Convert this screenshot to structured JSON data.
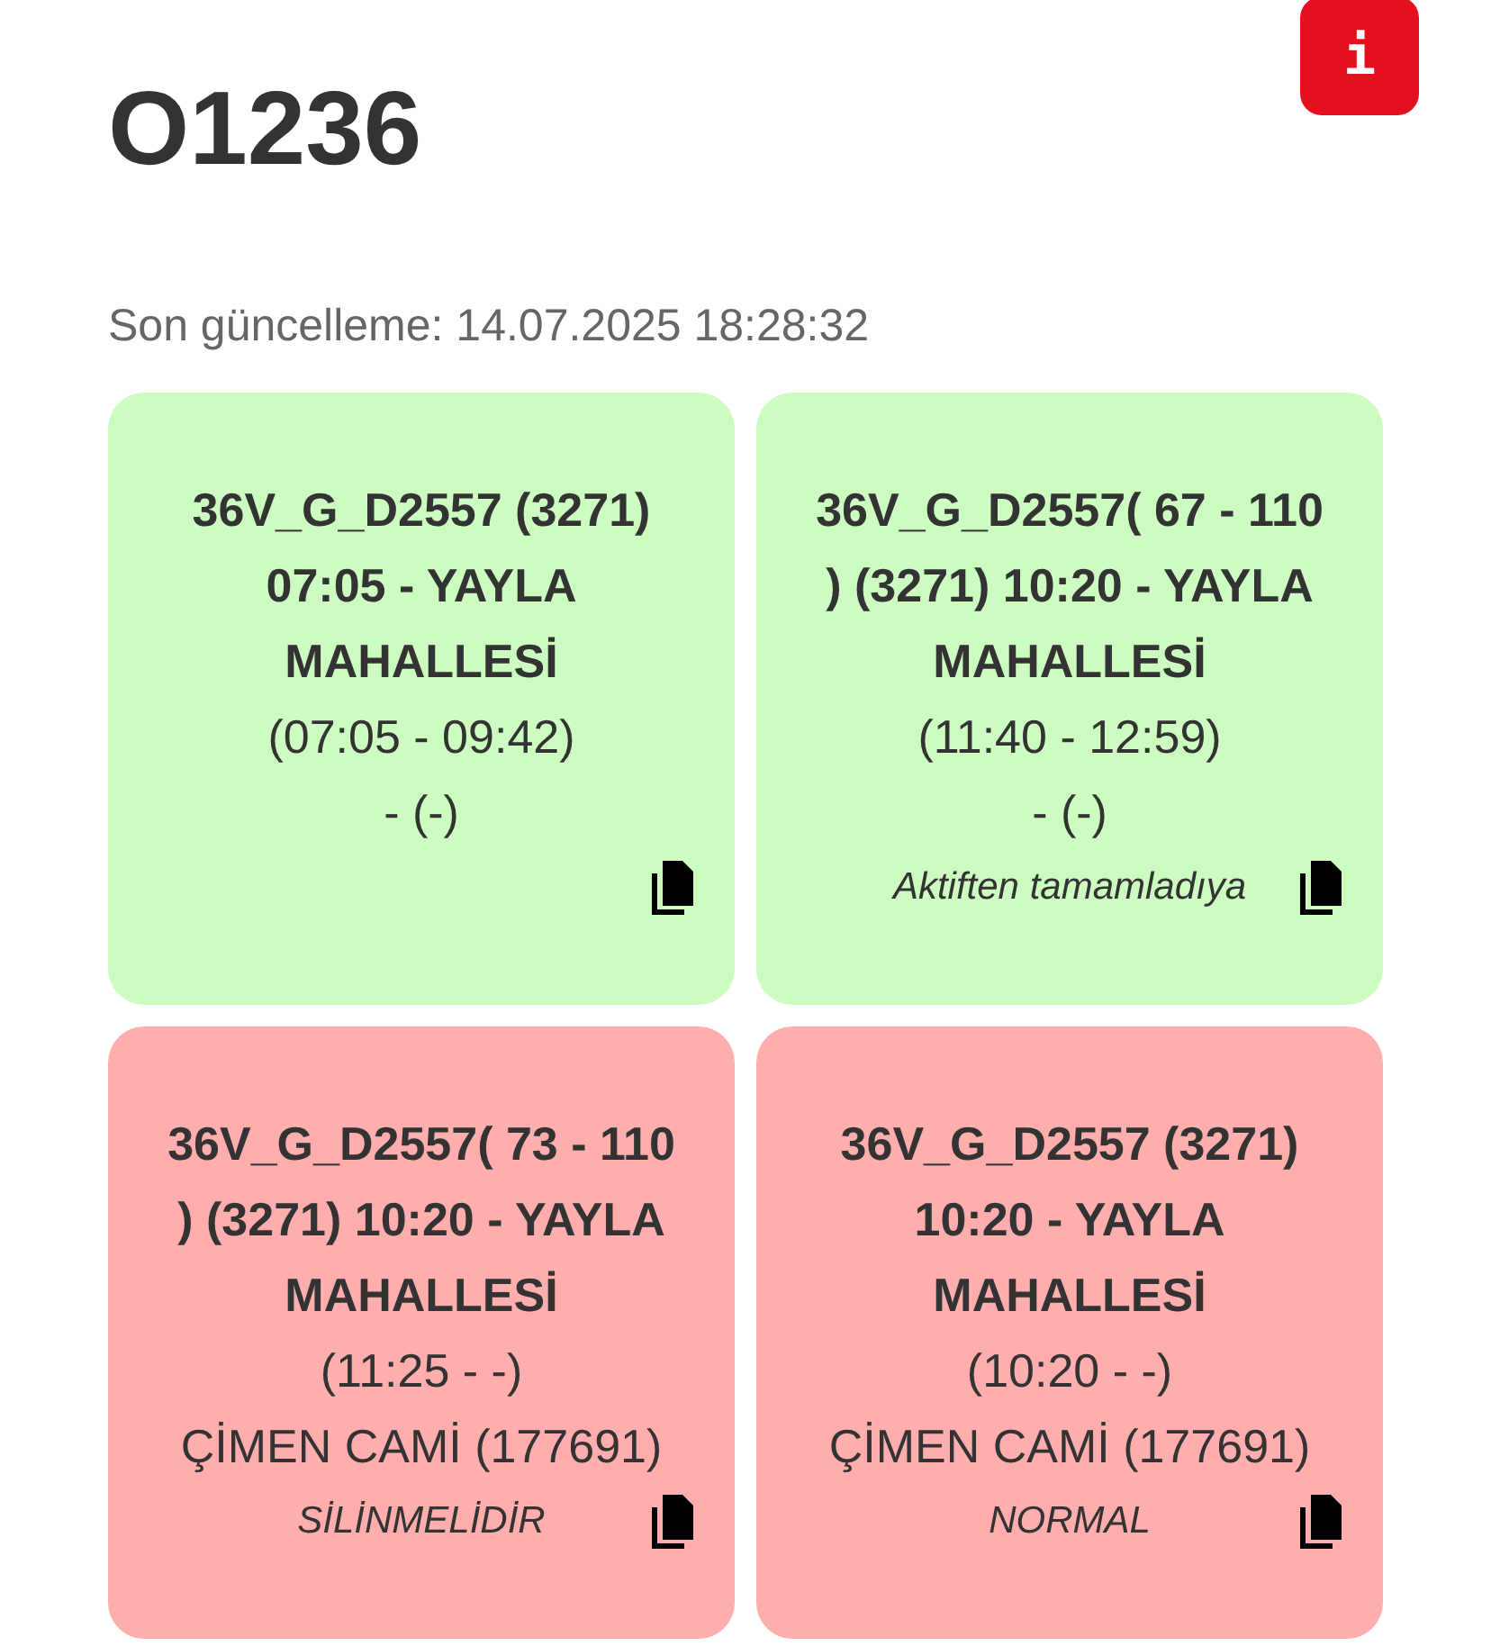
{
  "header": {
    "title": "O1236",
    "info_button": "i"
  },
  "last_update": "Son güncelleme: 14.07.2025 18:28:32",
  "cards": [
    {
      "color": "#ccfcc0",
      "title": "36V_G_D2557 (3271) 07:05 - YAYLA MAHALLESİ",
      "time": "(07:05 - 09:42)",
      "place": "- (-)"
    },
    {
      "color": "#ccfcc0",
      "title": "36V_G_D2557( 67 - 110 ) (3271) 10:20 - YAYLA MAHALLESİ",
      "time": "(11:40 - 12:59)",
      "place": "- (-)",
      "note": "Aktiften tamamladıya"
    },
    {
      "color": "#ffadad",
      "title": "36V_G_D2557( 73 - 110 ) (3271) 10:20 - YAYLA MAHALLESİ",
      "time": "(11:25 - -)",
      "place": "ÇİMEN CAMİ (177691)",
      "note": "SİLİNMELİDİR"
    },
    {
      "color": "#ffadad",
      "title": "36V_G_D2557 (3271) 10:20 - YAYLA MAHALLESİ",
      "time": "(10:20 - -)",
      "place": "ÇİMEN CAMİ (177691)",
      "note": "NORMAL"
    }
  ]
}
